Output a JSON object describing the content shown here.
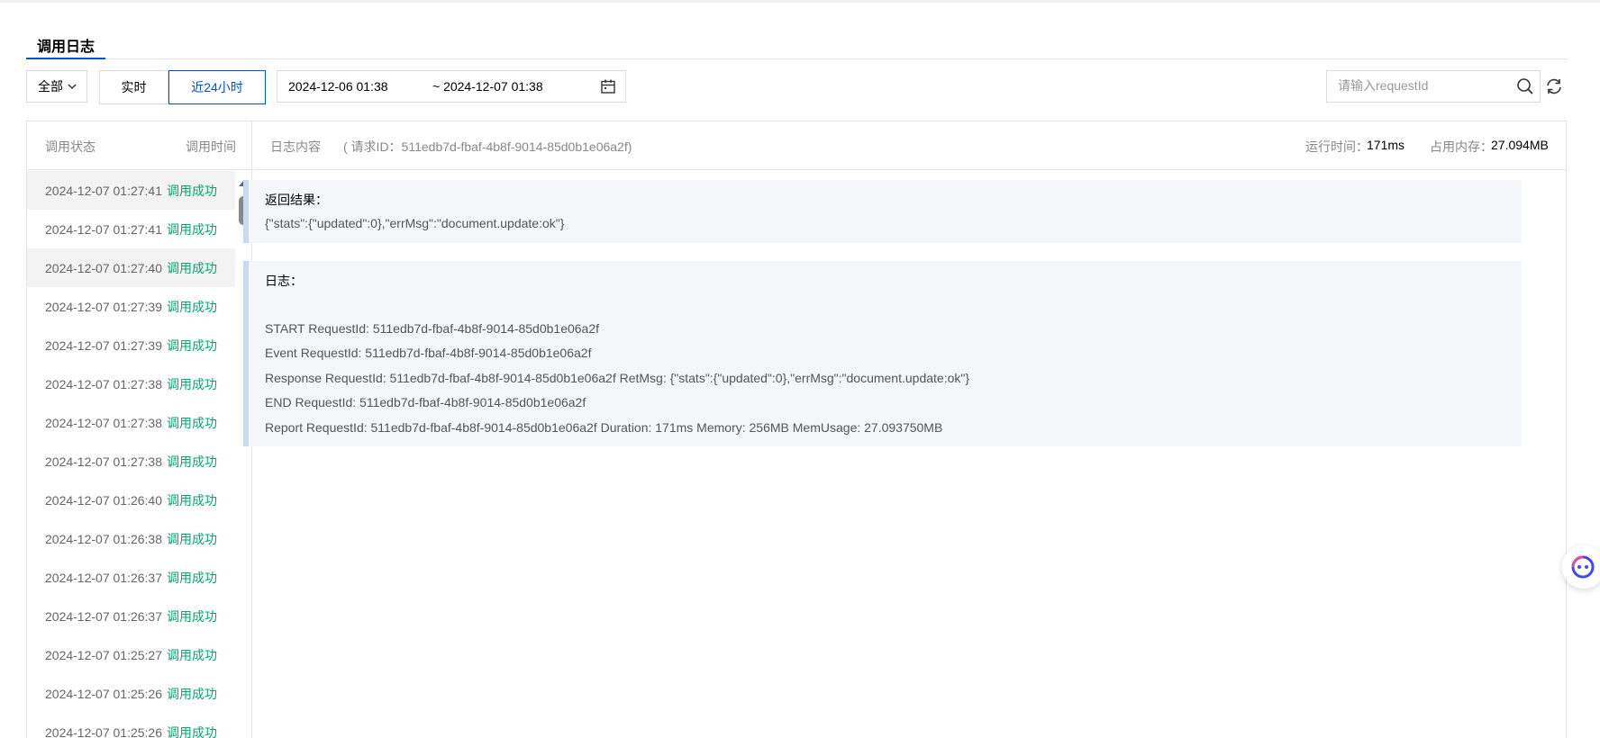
{
  "tab": {
    "label": "调用日志"
  },
  "filter": {
    "select_value": "全部",
    "realtime_label": "实时",
    "last24h_label": "近24小时",
    "range_start": "2024-12-06 01:38",
    "range_end": "~ 2024-12-07 01:38",
    "search_placeholder": "请输入requestId"
  },
  "list": {
    "header_status": "调用状态",
    "header_time": "调用时间",
    "rows": [
      {
        "time": "2024-12-07 01:27:41",
        "status": "调用成功"
      },
      {
        "time": "2024-12-07 01:27:41",
        "status": "调用成功"
      },
      {
        "time": "2024-12-07 01:27:40",
        "status": "调用成功"
      },
      {
        "time": "2024-12-07 01:27:39",
        "status": "调用成功"
      },
      {
        "time": "2024-12-07 01:27:39",
        "status": "调用成功"
      },
      {
        "time": "2024-12-07 01:27:38",
        "status": "调用成功"
      },
      {
        "time": "2024-12-07 01:27:38",
        "status": "调用成功"
      },
      {
        "time": "2024-12-07 01:27:38",
        "status": "调用成功"
      },
      {
        "time": "2024-12-07 01:26:40",
        "status": "调用成功"
      },
      {
        "time": "2024-12-07 01:26:38",
        "status": "调用成功"
      },
      {
        "time": "2024-12-07 01:26:37",
        "status": "调用成功"
      },
      {
        "time": "2024-12-07 01:26:37",
        "status": "调用成功"
      },
      {
        "time": "2024-12-07 01:25:27",
        "status": "调用成功"
      },
      {
        "time": "2024-12-07 01:25:26",
        "status": "调用成功"
      },
      {
        "time": "2024-12-07 01:25:26",
        "status": "调用成功"
      }
    ]
  },
  "detail": {
    "title": "日志内容",
    "request_id": "( 请求ID：511edb7d-fbaf-4b8f-9014-85d0b1e06a2f)",
    "runtime_label": "运行时间：",
    "runtime_value": "171ms",
    "memory_label": "占用内存：",
    "memory_value": "27.094MB",
    "result_label": "返回结果：",
    "result_value": "{\"stats\":{\"updated\":0},\"errMsg\":\"document.update:ok\"}",
    "log_label": "日志：",
    "log_lines": [
      " START RequestId: 511edb7d-fbaf-4b8f-9014-85d0b1e06a2f",
      "Event RequestId: 511edb7d-fbaf-4b8f-9014-85d0b1e06a2f",
      "Response RequestId: 511edb7d-fbaf-4b8f-9014-85d0b1e06a2f RetMsg: {\"stats\":{\"updated\":0},\"errMsg\":\"document.update:ok\"}",
      "END RequestId: 511edb7d-fbaf-4b8f-9014-85d0b1e06a2f",
      "Report RequestId: 511edb7d-fbaf-4b8f-9014-85d0b1e06a2f Duration: 171ms Memory: 256MB MemUsage: 27.093750MB"
    ]
  },
  "colors": {
    "accent": "#0052d9",
    "success": "#00a870",
    "block_bg": "#f4f6f9",
    "block_border": "#c8daf3"
  },
  "icons": [
    "chevron-down-icon",
    "calendar-icon",
    "search-icon",
    "refresh-icon",
    "scroll-up-icon",
    "assistant-bot-icon"
  ]
}
